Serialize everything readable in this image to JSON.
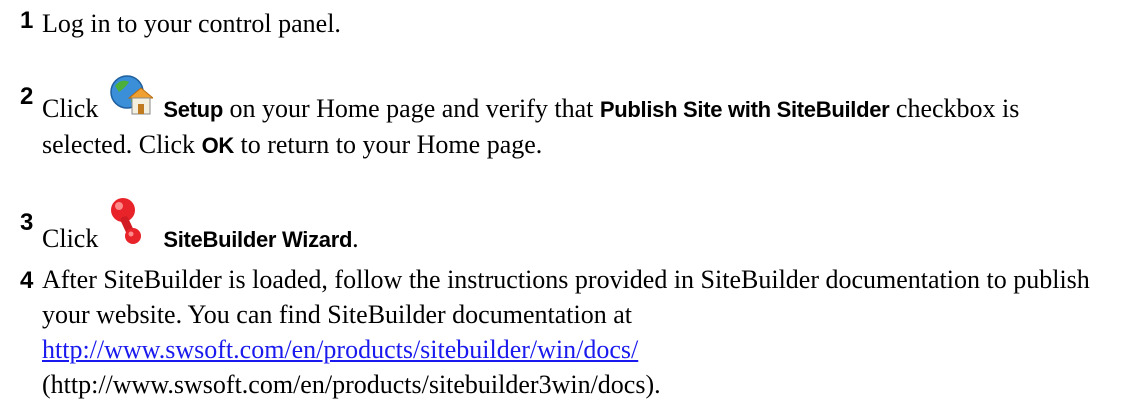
{
  "steps": [
    {
      "number": "1",
      "text": "Log in to your control panel."
    },
    {
      "number": "2",
      "click": "Click",
      "icon": "setup-globe-house-icon",
      "setup_label": "Setup",
      "mid1": " on your Home page and verify that ",
      "checkbox_label": "Publish Site with SiteBuilder",
      "mid2": " checkbox is selected. Click ",
      "ok_label": "OK",
      "end": " to return to your Home page."
    },
    {
      "number": "3",
      "click": "Click",
      "icon": "sitebuilder-wizard-icon",
      "wizard_label": "SiteBuilder Wizard",
      "end": "."
    },
    {
      "number": "4",
      "text": "After SiteBuilder is loaded, follow the instructions provided in SiteBuilder documentation to publish your website. You can find SiteBuilder documentation at ",
      "link": "http://www.swsoft.com/en/products/sitebuilder/win/docs/",
      "after_link": " (http://www.swsoft.com/en/products/sitebuilder3win/docs)."
    }
  ],
  "colors": {
    "link": "#1a1aee",
    "text": "#000000"
  }
}
